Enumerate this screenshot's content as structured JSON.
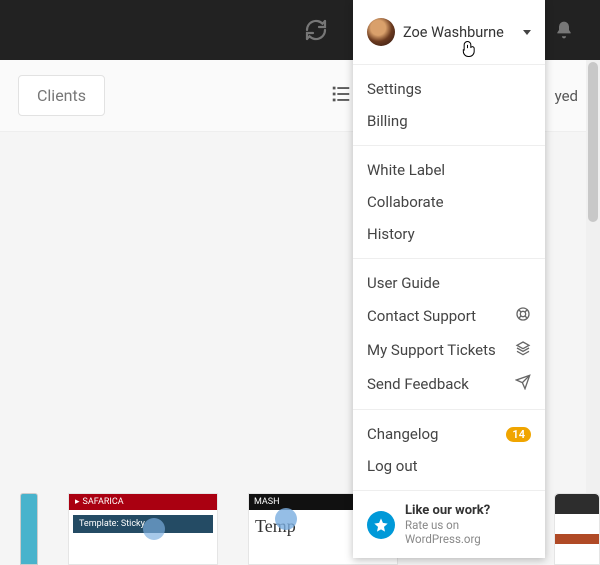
{
  "topbar": {
    "refresh_icon": "refresh-icon",
    "bell_icon": "bell-icon"
  },
  "subbar": {
    "tab_label": "Clients",
    "right_text": "yed"
  },
  "user": {
    "name": "Zoe Washburne"
  },
  "menu": {
    "settings": "Settings",
    "billing": "Billing",
    "white_label": "White Label",
    "collaborate": "Collaborate",
    "history": "History",
    "user_guide": "User Guide",
    "contact_support": "Contact Support",
    "my_tickets": "My Support Tickets",
    "send_feedback": "Send Feedback",
    "changelog": "Changelog",
    "changelog_badge": "14",
    "logout": "Log out"
  },
  "like": {
    "title": "Like our work?",
    "subtitle": "Rate us on WordPress.org"
  },
  "cards": {
    "c2_header": "SAFARICA",
    "c2_bar": "Template: Sticky",
    "c3_header": "MASH",
    "c3_body": "Temp"
  }
}
